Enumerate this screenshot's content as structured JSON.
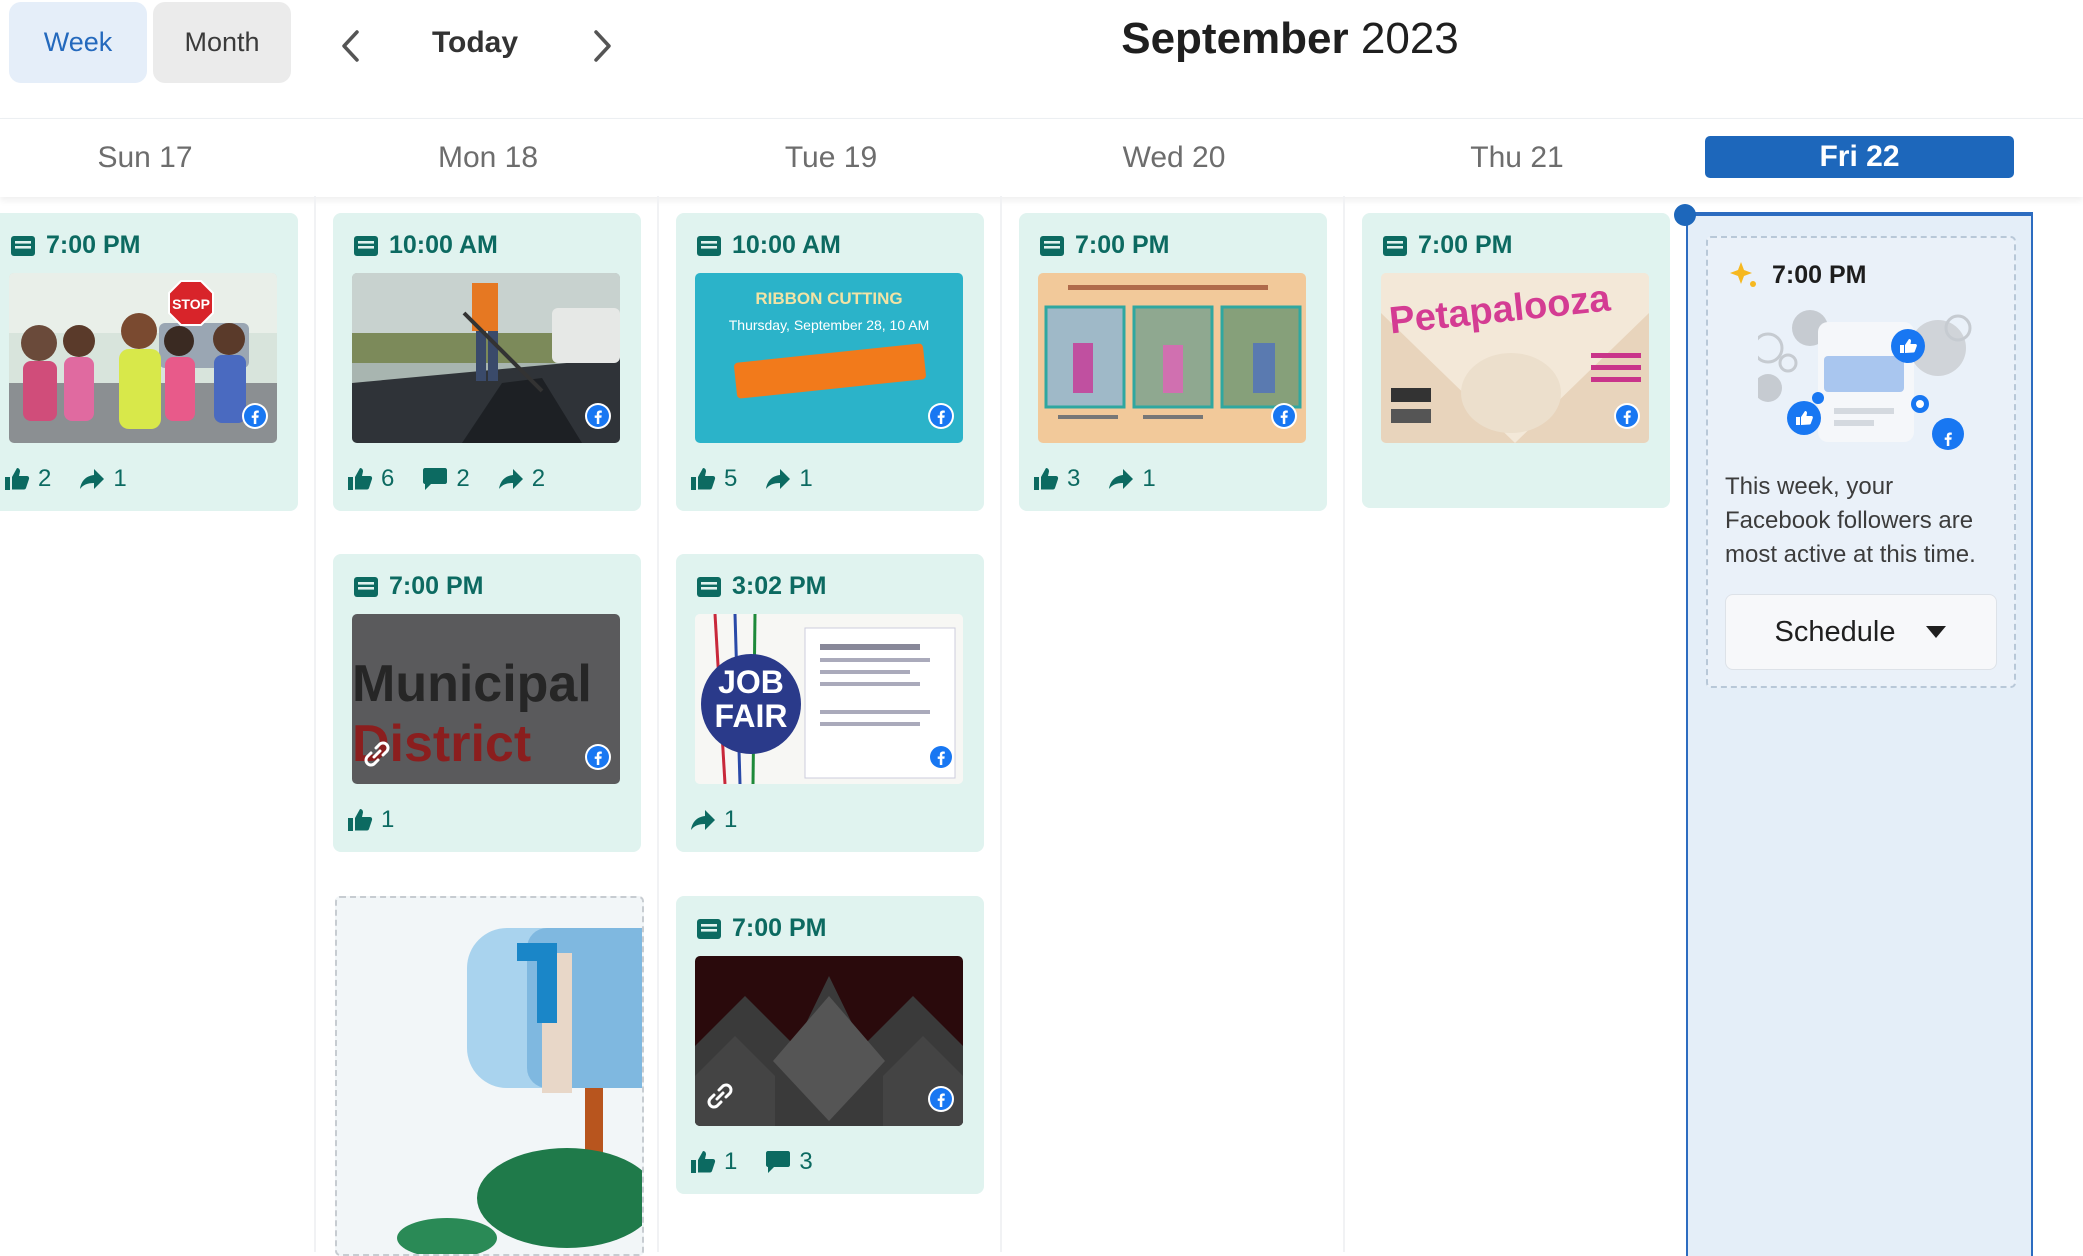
{
  "toolbar": {
    "view_week": "Week",
    "view_month": "Month",
    "today": "Today",
    "month_name": "September",
    "year": "2023"
  },
  "days": [
    "Sun 17",
    "Mon 18",
    "Tue 19",
    "Wed 20",
    "Thu 21",
    "Fri 22"
  ],
  "posts": {
    "sun_1": {
      "time": "7:00 PM",
      "likes": "2",
      "shares": "1"
    },
    "mon_1": {
      "time": "10:00 AM",
      "likes": "6",
      "comments": "2",
      "shares": "2"
    },
    "mon_2": {
      "time": "7:00 PM",
      "likes": "1",
      "thumb_title": "Municipal",
      "thumb_title2": "District"
    },
    "tue_1": {
      "time": "10:00 AM",
      "likes": "5",
      "shares": "1",
      "thumb_title": "RIBBON CUTTING",
      "thumb_date": "Thursday, September 28, 10 AM"
    },
    "tue_2": {
      "time": "3:02 PM",
      "shares": "1",
      "thumb_title": "JOB",
      "thumb_title2": "FAIR"
    },
    "tue_3": {
      "time": "7:00 PM",
      "likes": "1",
      "comments": "3"
    },
    "wed_1": {
      "time": "7:00 PM",
      "likes": "3",
      "shares": "1"
    },
    "thu_1": {
      "time": "7:00 PM",
      "thumb_title": "Petapalooza"
    }
  },
  "suggestion": {
    "time": "7:00 PM",
    "text": "This week, your Facebook followers are most active at this time.",
    "button": "Schedule"
  },
  "colors": {
    "accent": "#1d67bb",
    "card_bg": "#e0f3ef",
    "card_text": "#0c6a61",
    "facebook": "#1877f2"
  }
}
